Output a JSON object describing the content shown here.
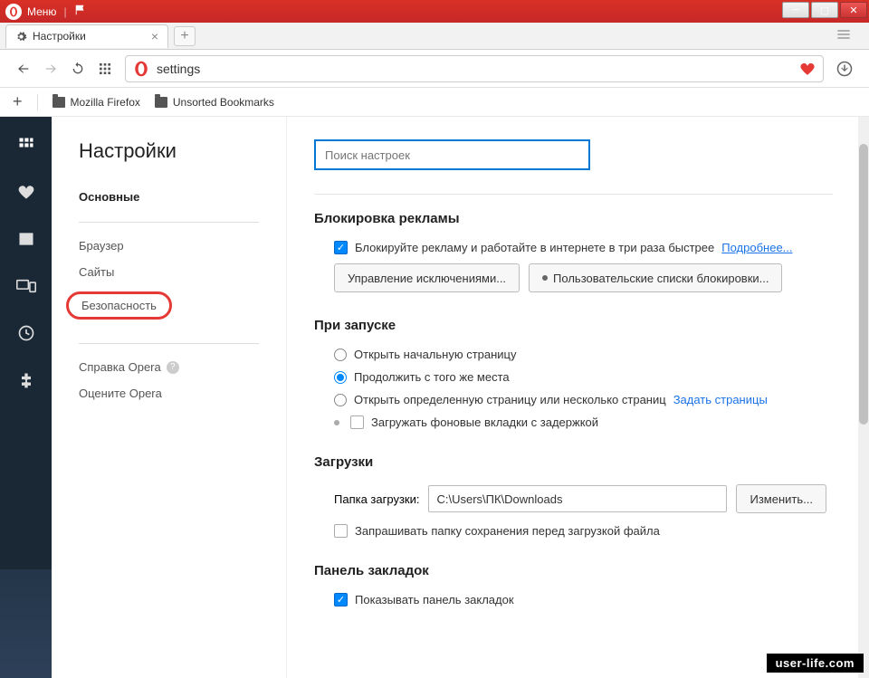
{
  "titlebar": {
    "menu": "Меню"
  },
  "tab": {
    "title": "Настройки"
  },
  "url": {
    "value": "settings"
  },
  "bookmarks": {
    "add": "+",
    "item1": "Mozilla Firefox",
    "item2": "Unsorted Bookmarks"
  },
  "settingsNav": {
    "title": "Настройки",
    "main": "Основные",
    "browser": "Браузер",
    "sites": "Сайты",
    "security": "Безопасность",
    "help": "Справка Opera",
    "rate": "Оцените Opera"
  },
  "search": {
    "placeholder": "Поиск настроек"
  },
  "adblock": {
    "title": "Блокировка рекламы",
    "check_label": "Блокируйте рекламу и работайте в интернете в три раза быстрее",
    "more": "Подробнее...",
    "btn1": "Управление исключениями...",
    "btn2": "Пользовательские списки блокировки..."
  },
  "startup": {
    "title": "При запуске",
    "opt1": "Открыть начальную страницу",
    "opt2": "Продолжить с того же места",
    "opt3": "Открыть определенную страницу или несколько страниц",
    "opt3_link": "Задать страницы",
    "opt4": "Загружать фоновые вкладки с задержкой"
  },
  "downloads": {
    "title": "Загрузки",
    "label": "Папка загрузки:",
    "path": "C:\\Users\\ПК\\Downloads",
    "change": "Изменить...",
    "ask": "Запрашивать папку сохранения перед загрузкой файла"
  },
  "bookmarksPanel": {
    "title": "Панель закладок",
    "show": "Показывать панель закладок"
  },
  "footer": "user-life.com"
}
